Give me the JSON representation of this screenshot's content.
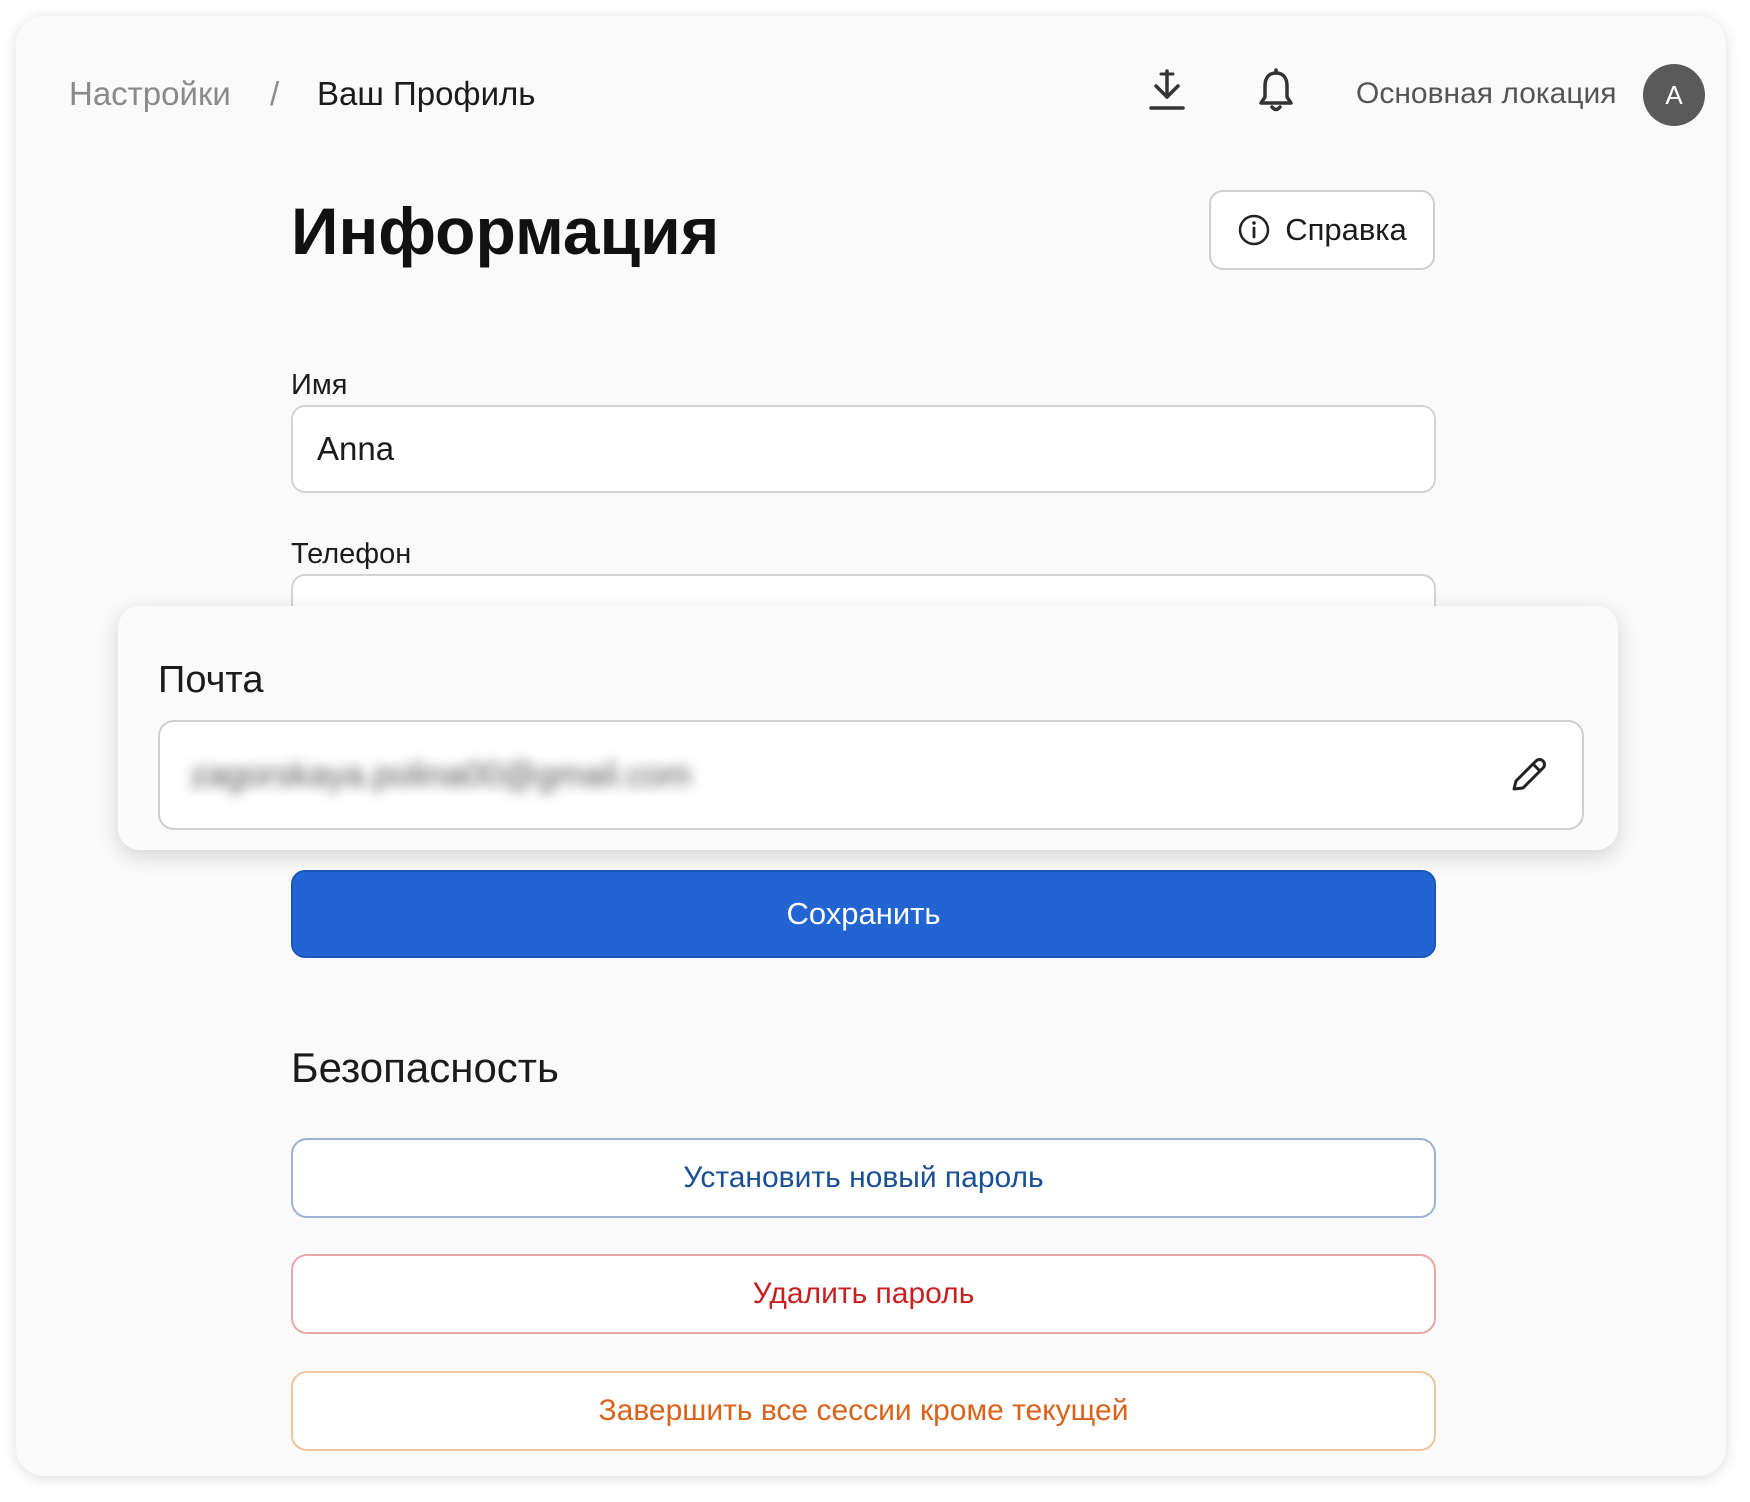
{
  "header": {
    "breadcrumb_root": "Настройки",
    "breadcrumb_separator": "/",
    "breadcrumb_current": "Ваш Профиль",
    "download_icon": "download-icon",
    "bell_icon": "bell-icon",
    "location": "Основная локация",
    "avatar_initial": "A"
  },
  "main": {
    "title": "Информация",
    "help_label": "Справка",
    "help_icon": "info-icon"
  },
  "form": {
    "name_label": "Имя",
    "name_value": "Anna",
    "phone_label": "Телефон",
    "phone_value": "",
    "email_label": "Почта",
    "email_value": "zagorskaya.polina00@gmail.com",
    "email_edit_icon": "pencil-icon",
    "save_label": "Сохранить"
  },
  "security": {
    "title": "Безопасность",
    "new_password_label": "Установить новый пароль",
    "delete_password_label": "Удалить пароль",
    "end_sessions_label": "Завершить все сессии кроме текущей"
  },
  "colors": {
    "primary": "#2164d2",
    "danger": "#c81f1f",
    "warning": "#d9631a",
    "link": "#1a4f96"
  }
}
